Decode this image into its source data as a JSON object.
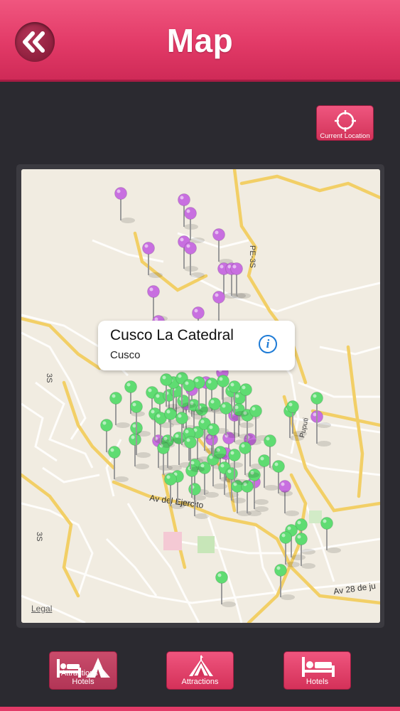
{
  "header": {
    "title": "Map",
    "back_icon": "double-chevron-left-icon"
  },
  "current_location": {
    "label": "Current Location",
    "icon": "crosshair-icon"
  },
  "map": {
    "legal_label": "Legal",
    "street_labels": {
      "pe3s": "PE-3S",
      "s3_upper": "3S",
      "s3_lower": "3S",
      "ejercito": "Av del Ejercito",
      "puputi": "Puputi",
      "av28": "Av 28 de ju"
    },
    "callout": {
      "title": "Cusco La Catedral",
      "subtitle": "Cusco",
      "icon": "info-icon"
    },
    "pin_colors": {
      "attraction": "#c86fe0",
      "hotel": "#5fdc72"
    }
  },
  "tabs": [
    {
      "label": "Attractions & Hotels",
      "icon": "bed-and-tent-icon",
      "active": true
    },
    {
      "label": "Attractions",
      "icon": "tent-icon",
      "active": false
    },
    {
      "label": "Hotels",
      "icon": "bed-icon",
      "active": false
    }
  ],
  "colors": {
    "accent": "#e23a67",
    "background": "#2b2a30"
  }
}
